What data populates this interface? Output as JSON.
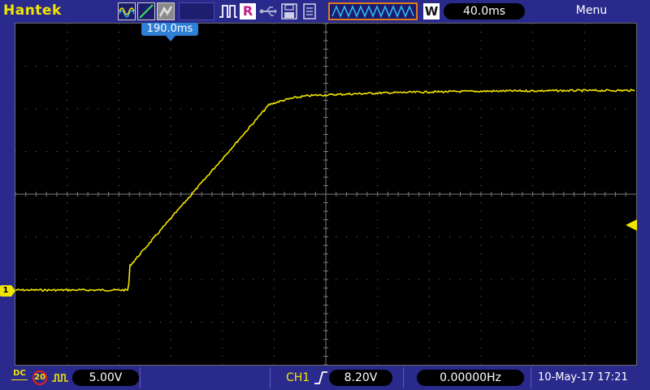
{
  "header": {
    "brand": "Hantek",
    "acq_icons": [
      "sine-mode-icon",
      "ramp-mode-icon",
      "envelope-mode-icon"
    ],
    "pulse_icon": "pulse-icon",
    "run_badge": "R",
    "usb_icon": "usb-icon",
    "save_icon": "floppy-disk-icon",
    "doc_icon": "document-icon",
    "wave_icon": "waveform-memory-icon",
    "window_badge": "W",
    "timebase": "40.0ms",
    "menu_label": "Menu"
  },
  "screen": {
    "trigger_position": "190.0ms",
    "channel_marker": "1"
  },
  "footer": {
    "coupling": "DC",
    "bw_limit": "20",
    "probe_icon": "probe-icon",
    "volts_div": "5.00V",
    "trigger_source": "CH1",
    "trigger_edge_icon": "rising-edge-icon",
    "trigger_level": "8.20V",
    "frequency": "0.00000Hz",
    "datetime": "10-May-17 17:21"
  },
  "colors": {
    "background": "#2a2a8c",
    "trace": "#f2e600",
    "grid": "#7a7a7a",
    "trigger_marker": "#2e7fd6"
  }
}
